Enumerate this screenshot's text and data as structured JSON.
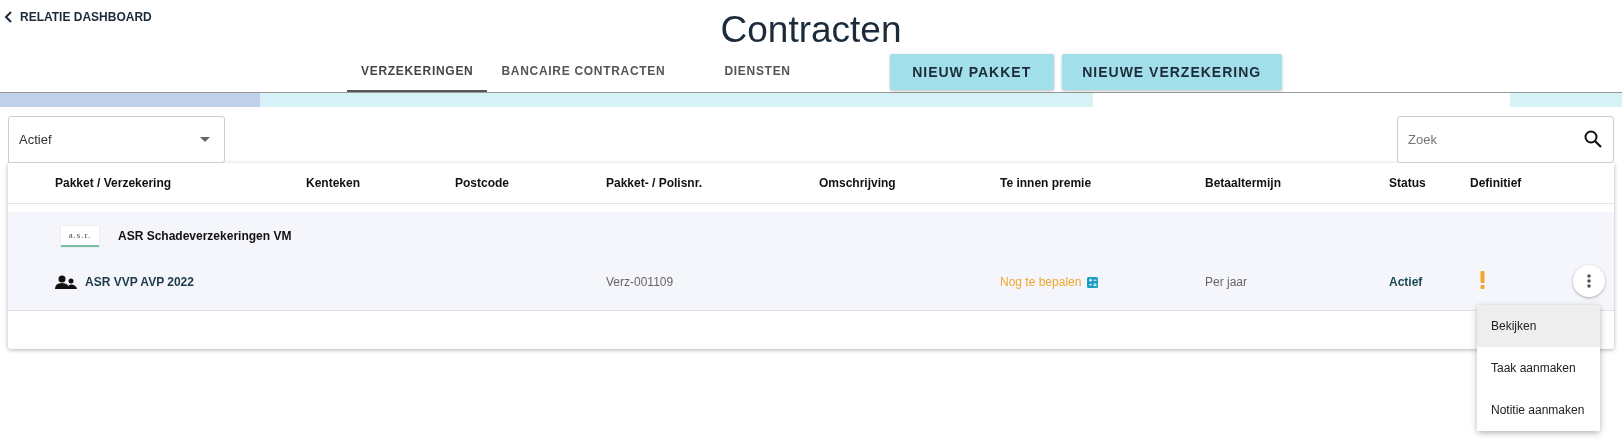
{
  "back_link": "RELATIE DASHBOARD",
  "title": "Contracten",
  "tabs": [
    {
      "label": "VERZEKERINGEN",
      "selected": true
    },
    {
      "label": "BANCAIRE CONTRACTEN",
      "selected": false
    },
    {
      "label": "DIENSTEN",
      "selected": false
    }
  ],
  "buttons": [
    "NIEUW PAKKET",
    "NIEUWE VERZEKERING"
  ],
  "filter": {
    "value": "Actief"
  },
  "search": {
    "placeholder": "Zoek"
  },
  "table": {
    "columns": [
      "Pakket / Verzekering",
      "Kenteken",
      "Postcode",
      "Pakket- / Polisnr.",
      "Omschrijving",
      "Te innen premie",
      "Betaaltermijn",
      "Status",
      "Definitief"
    ],
    "groups": [
      {
        "logo": "a.s.r.",
        "insurer": "ASR Schadeverzekeringen VM",
        "rows": [
          {
            "name": "ASR VVP AVP 2022",
            "polisnr": "Verz-001109",
            "premie": "Nog te bepalen",
            "betaaltermijn": "Per jaar",
            "status": "Actief",
            "warning": true
          }
        ]
      }
    ]
  },
  "menu": {
    "items": [
      {
        "label": "Bekijken",
        "selected": true
      },
      {
        "label": "Taak aanmaken",
        "selected": false
      },
      {
        "label": "Notitie aanmaken",
        "selected": false
      }
    ]
  }
}
